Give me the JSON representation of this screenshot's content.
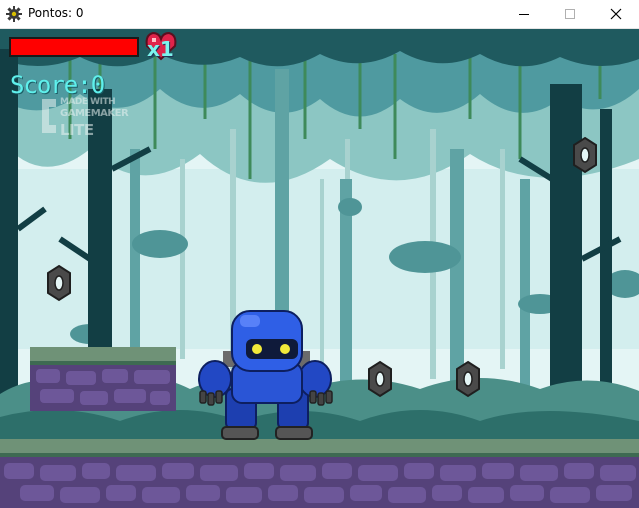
{
  "window": {
    "title": "Pontos: 0",
    "icon": "gear-icon",
    "controls": [
      "minimize-icon",
      "maximize-icon",
      "close-icon"
    ]
  },
  "hud": {
    "health_fraction": 1.0,
    "health_color": "#ff0000",
    "lives_text": "x1",
    "score_text": "Score:0",
    "score_color": "#5ff0ec"
  },
  "watermark": {
    "line1": "MADE WITH",
    "line2": "GAMEMAKER",
    "line3": "LITE"
  },
  "scene": {
    "sky_color": "#e4f5f5",
    "ground_color": "#5a3f80",
    "grass_color": "#6c8e70",
    "player": "blue-robot",
    "collectibles": "nut-icon"
  }
}
